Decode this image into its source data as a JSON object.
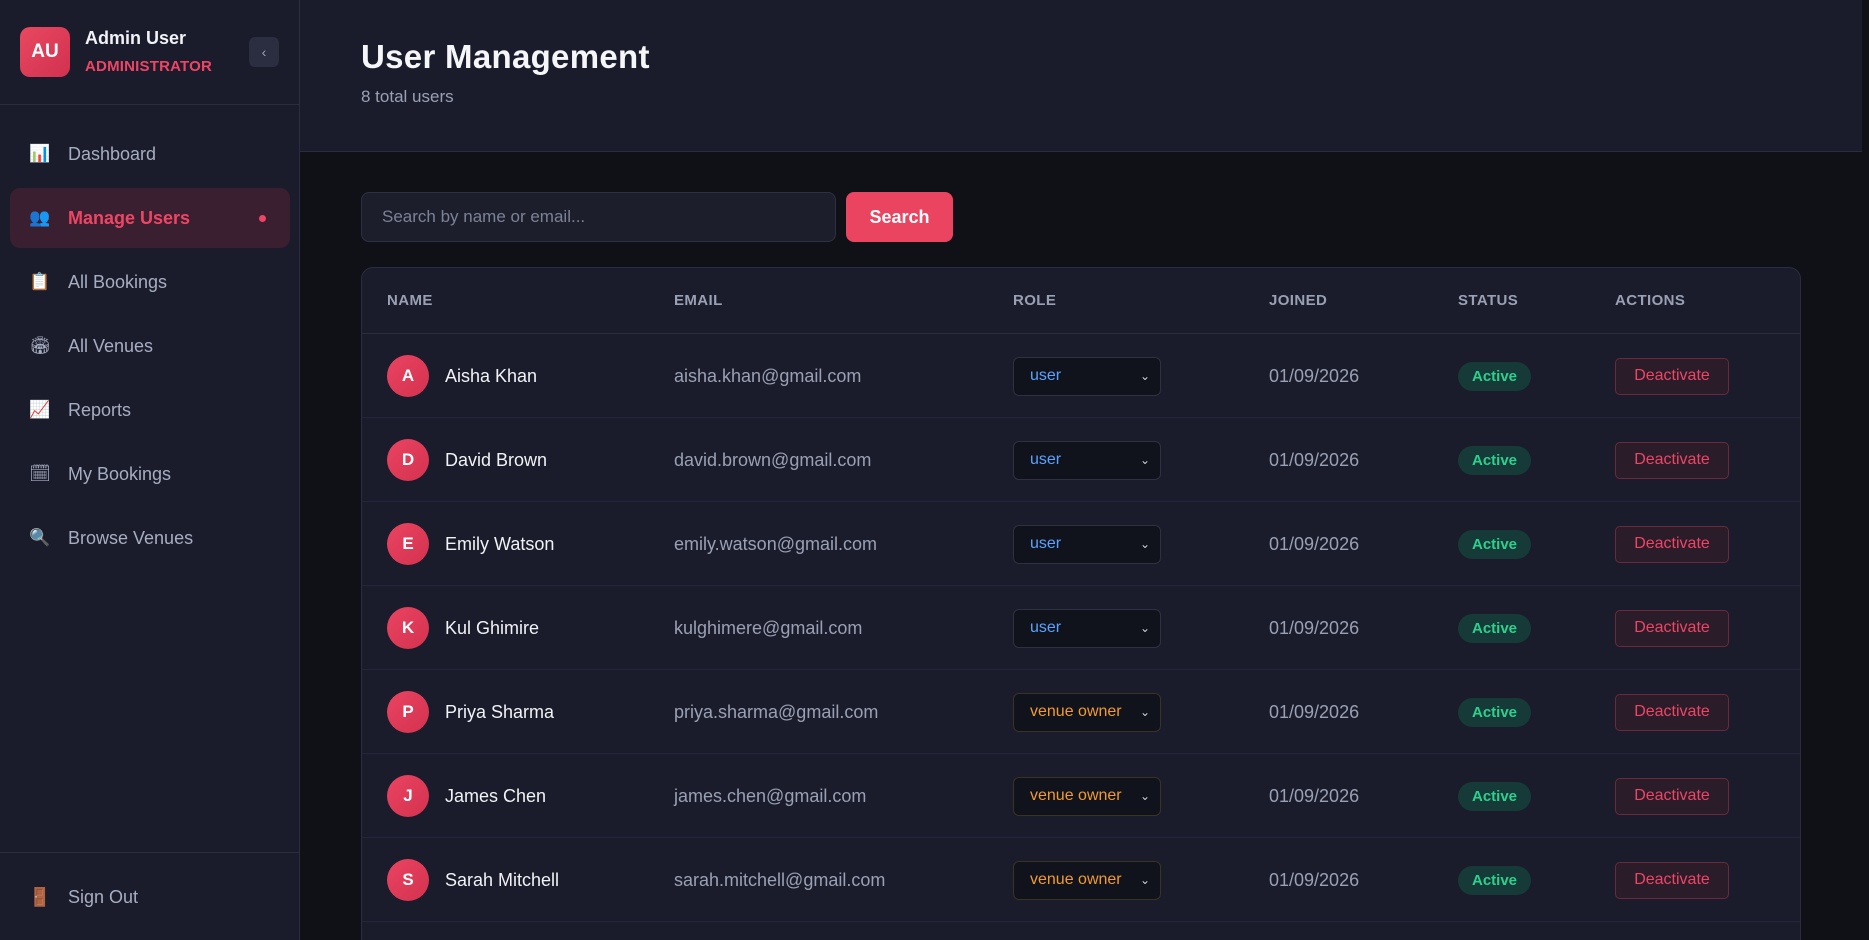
{
  "profile": {
    "initials": "AU",
    "name": "Admin User",
    "role": "ADMINISTRATOR",
    "collapse_label": "‹"
  },
  "nav": {
    "items": [
      {
        "label": "Dashboard",
        "icon": "📊"
      },
      {
        "label": "Manage Users",
        "icon": "👥"
      },
      {
        "label": "All Bookings",
        "icon": "📋"
      },
      {
        "label": "All Venues",
        "icon": "🏟"
      },
      {
        "label": "Reports",
        "icon": "📈"
      },
      {
        "label": "My Bookings",
        "icon": "🗓"
      },
      {
        "label": "Browse Venues",
        "icon": "🔍"
      }
    ],
    "signout_label": "Sign Out",
    "signout_icon": "🚪"
  },
  "header": {
    "title": "User Management",
    "subtitle": "8 total users"
  },
  "search": {
    "placeholder": "Search by name or email...",
    "button_label": "Search"
  },
  "table": {
    "headers": {
      "name": "NAME",
      "email": "EMAIL",
      "role": "ROLE",
      "joined": "JOINED",
      "status": "STATUS",
      "actions": "ACTIONS"
    },
    "rows": [
      {
        "initial": "A",
        "name": "Aisha Khan",
        "email": "aisha.khan@gmail.com",
        "role": "user",
        "joined": "01/09/2026",
        "status": "Active",
        "action": "Deactivate"
      },
      {
        "initial": "D",
        "name": "David Brown",
        "email": "david.brown@gmail.com",
        "role": "user",
        "joined": "01/09/2026",
        "status": "Active",
        "action": "Deactivate"
      },
      {
        "initial": "E",
        "name": "Emily Watson",
        "email": "emily.watson@gmail.com",
        "role": "user",
        "joined": "01/09/2026",
        "status": "Active",
        "action": "Deactivate"
      },
      {
        "initial": "K",
        "name": "Kul Ghimire",
        "email": "kulghimere@gmail.com",
        "role": "user",
        "joined": "01/09/2026",
        "status": "Active",
        "action": "Deactivate"
      },
      {
        "initial": "P",
        "name": "Priya Sharma",
        "email": "priya.sharma@gmail.com",
        "role": "venue owner",
        "joined": "01/09/2026",
        "status": "Active",
        "action": "Deactivate"
      },
      {
        "initial": "J",
        "name": "James Chen",
        "email": "james.chen@gmail.com",
        "role": "venue owner",
        "joined": "01/09/2026",
        "status": "Active",
        "action": "Deactivate"
      },
      {
        "initial": "S",
        "name": "Sarah Mitchell",
        "email": "sarah.mitchell@gmail.com",
        "role": "venue owner",
        "joined": "01/09/2026",
        "status": "Active",
        "action": "Deactivate"
      }
    ]
  },
  "colors": {
    "accent": "#ea4461",
    "user_role": "#5aa2ff",
    "owner_role": "#f29a2e",
    "active": "#2fd08d"
  }
}
